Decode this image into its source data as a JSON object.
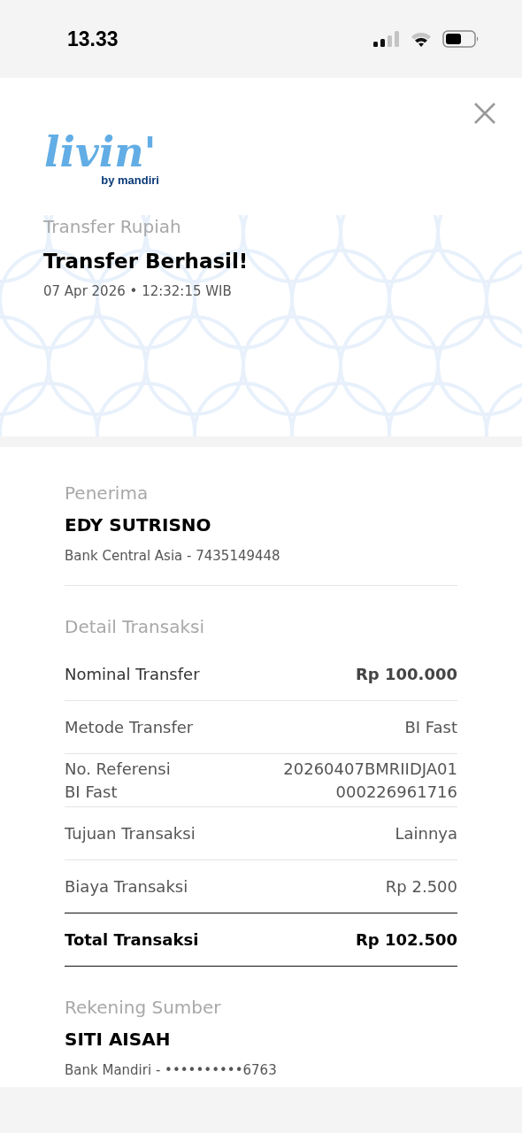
{
  "status_bar": {
    "time": "13.33"
  },
  "header": {
    "logo_word": "livin'",
    "logo_sub": "by mandiri",
    "category": "Transfer Rupiah",
    "title": "Transfer Berhasil!",
    "datetime": "07 Apr 2026 • 12:32:15 WIB"
  },
  "recipient": {
    "label": "Penerima",
    "name": "EDY SUTRISNO",
    "account": "Bank Central Asia - 7435149448"
  },
  "details": {
    "label": "Detail Transaksi",
    "rows": [
      {
        "kind": "main",
        "label": "Nominal Transfer",
        "value": "Rp 100.000"
      },
      {
        "kind": "plain",
        "label": "Metode Transfer",
        "value": "BI Fast"
      },
      {
        "kind": "multi",
        "label": "No. Referensi",
        "value": "20260407BMRIIDJA01",
        "label_2": "BI Fast",
        "value_2": "000226961716"
      },
      {
        "kind": "plain",
        "label": "Tujuan Transaksi",
        "value": "Lainnya"
      },
      {
        "kind": "plain",
        "label": "Biaya Transaksi",
        "value": "Rp 2.500"
      },
      {
        "kind": "total",
        "label": "Total Transaksi",
        "value": "Rp 102.500"
      }
    ]
  },
  "source": {
    "label": "Rekening Sumber",
    "name": "SITI AISAH",
    "account": "Bank Mandiri - ••••••••••6763"
  }
}
